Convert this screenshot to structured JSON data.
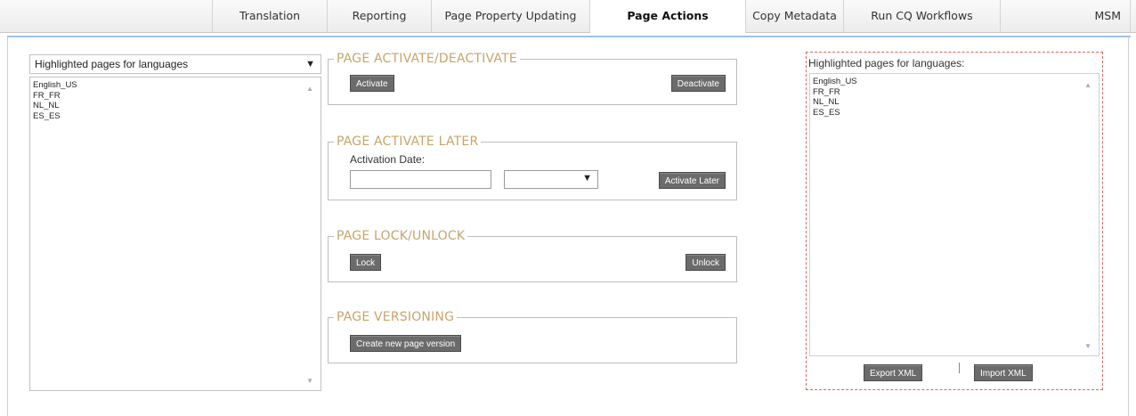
{
  "tabs": [
    {
      "label": "Translation"
    },
    {
      "label": "Reporting"
    },
    {
      "label": "Page Property Updating"
    },
    {
      "label": "Page Actions"
    },
    {
      "label": "Copy Metadata"
    },
    {
      "label": "Run CQ Workflows"
    },
    {
      "label": "MSM"
    }
  ],
  "active_tab": "Page Actions",
  "left": {
    "dropdown_selected": "Highlighted pages for languages",
    "items": [
      "English_US",
      "FR_FR",
      "NL_NL",
      "ES_ES"
    ]
  },
  "activate_section": {
    "legend": "PAGE ACTIVATE/DEACTIVATE",
    "activate_label": "Activate",
    "deactivate_label": "Deactivate"
  },
  "activate_later_section": {
    "legend": "PAGE ACTIVATE LATER",
    "date_label": "Activation Date:",
    "date_value": "",
    "time_value": "",
    "button_label": "Activate Later"
  },
  "lock_section": {
    "legend": "PAGE LOCK/UNLOCK",
    "lock_label": "Lock",
    "unlock_label": "Unlock"
  },
  "versioning_section": {
    "legend": "PAGE VERSIONING",
    "button_label": "Create new page version"
  },
  "right": {
    "title": "Highlighted pages for languages:",
    "items": [
      "English_US",
      "FR_FR",
      "NL_NL",
      "ES_ES"
    ],
    "export_label": "Export XML",
    "import_label": "Import XML"
  },
  "colors": {
    "legend": "#c8a46b",
    "button": "#6b6b6b",
    "panel_border": "#dd6666",
    "accent_line": "#9fc3e6"
  }
}
